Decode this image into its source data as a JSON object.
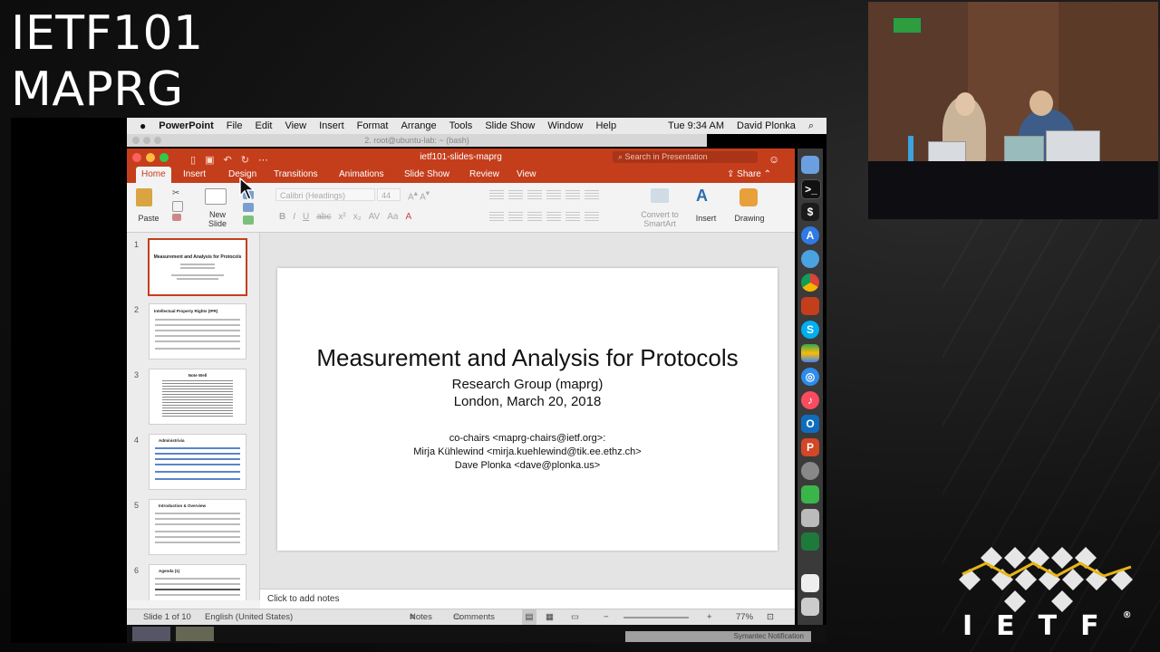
{
  "session": {
    "line1": "IETF101",
    "line2": "MAPRG"
  },
  "logo": {
    "text": "IETF",
    "registered": "®"
  },
  "mac_menubar": {
    "apple": "",
    "items": [
      "PowerPoint",
      "File",
      "Edit",
      "View",
      "Insert",
      "Format",
      "Arrange",
      "Tools",
      "Slide Show",
      "Window",
      "Help"
    ],
    "time": "Tue 9:34 AM",
    "user": "David Plonka",
    "search_icon": "⌕"
  },
  "terminal": {
    "title": "2. root@ubuntu-lab: ~ (bash)"
  },
  "ppt": {
    "doc_title": "ietf101-slides-maprg",
    "search_placeholder": "Search in Presentation",
    "tabs": [
      "Home",
      "Insert",
      "Design",
      "Transitions",
      "Animations",
      "Slide Show",
      "Review",
      "View"
    ],
    "share": "Share",
    "ribbon": {
      "paste": "Paste",
      "new_slide_line1": "New",
      "new_slide_line2": "Slide",
      "font": "Calibri (Headings)",
      "size": "44",
      "convert_line1": "Convert to",
      "convert_line2": "SmartArt",
      "insert": "Insert",
      "drawing": "Drawing"
    },
    "thumbnails": [
      "1",
      "2",
      "3",
      "4",
      "5",
      "6"
    ],
    "thumb_titles": {
      "t1": "Measurement and Analysis for Protocols",
      "t2": "Intellectual Property Rights (IPR)",
      "t3": "Note Well",
      "t4": "Administrivia",
      "t5": "Introduction & Overview",
      "t6": "Agenda (1)"
    },
    "slide": {
      "title": "Measurement and Analysis for Protocols",
      "subtitle1": "Research Group (maprg)",
      "subtitle2": "London, March 20, 2018",
      "cochairs": "co-chairs <maprg-chairs@ietf.org>:",
      "chair1": "Mirja Kühlewind <mirja.kuehlewind@tik.ee.ethz.ch>",
      "chair2": "Dave Plonka <dave@plonka.us>"
    },
    "notes_placeholder": "Click to add notes",
    "status": {
      "slide_counter": "Slide 1 of 10",
      "language": "English (United States)",
      "notes": "Notes",
      "comments": "Comments",
      "zoom_minus": "−",
      "zoom_plus": "+",
      "zoom": "77%"
    }
  },
  "notification": "Symantec Notification"
}
